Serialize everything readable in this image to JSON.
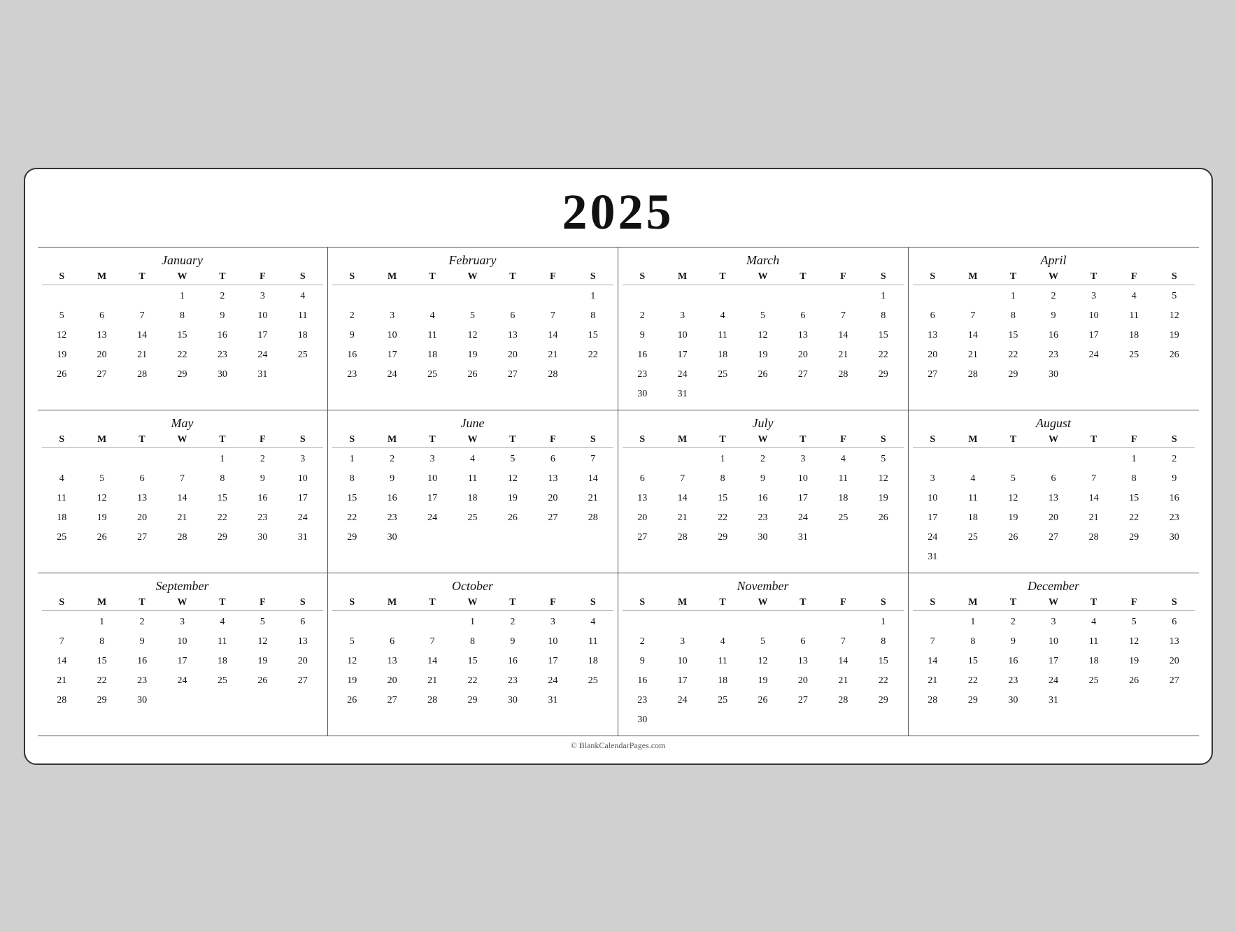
{
  "title": "2025",
  "footer": "© BlankCalendarPages.com",
  "dayHeaders": [
    "S",
    "M",
    "T",
    "W",
    "T",
    "F",
    "S"
  ],
  "months": [
    {
      "name": "January",
      "startDay": 3,
      "days": 31
    },
    {
      "name": "February",
      "startDay": 6,
      "days": 28
    },
    {
      "name": "March",
      "startDay": 6,
      "days": 31
    },
    {
      "name": "April",
      "startDay": 2,
      "days": 30
    },
    {
      "name": "May",
      "startDay": 4,
      "days": 31
    },
    {
      "name": "June",
      "startDay": 0,
      "days": 30
    },
    {
      "name": "July",
      "startDay": 2,
      "days": 31
    },
    {
      "name": "August",
      "startDay": 5,
      "days": 31
    },
    {
      "name": "September",
      "startDay": 1,
      "days": 30
    },
    {
      "name": "October",
      "startDay": 3,
      "days": 31
    },
    {
      "name": "November",
      "startDay": 6,
      "days": 30
    },
    {
      "name": "December",
      "startDay": 1,
      "days": 31
    }
  ]
}
